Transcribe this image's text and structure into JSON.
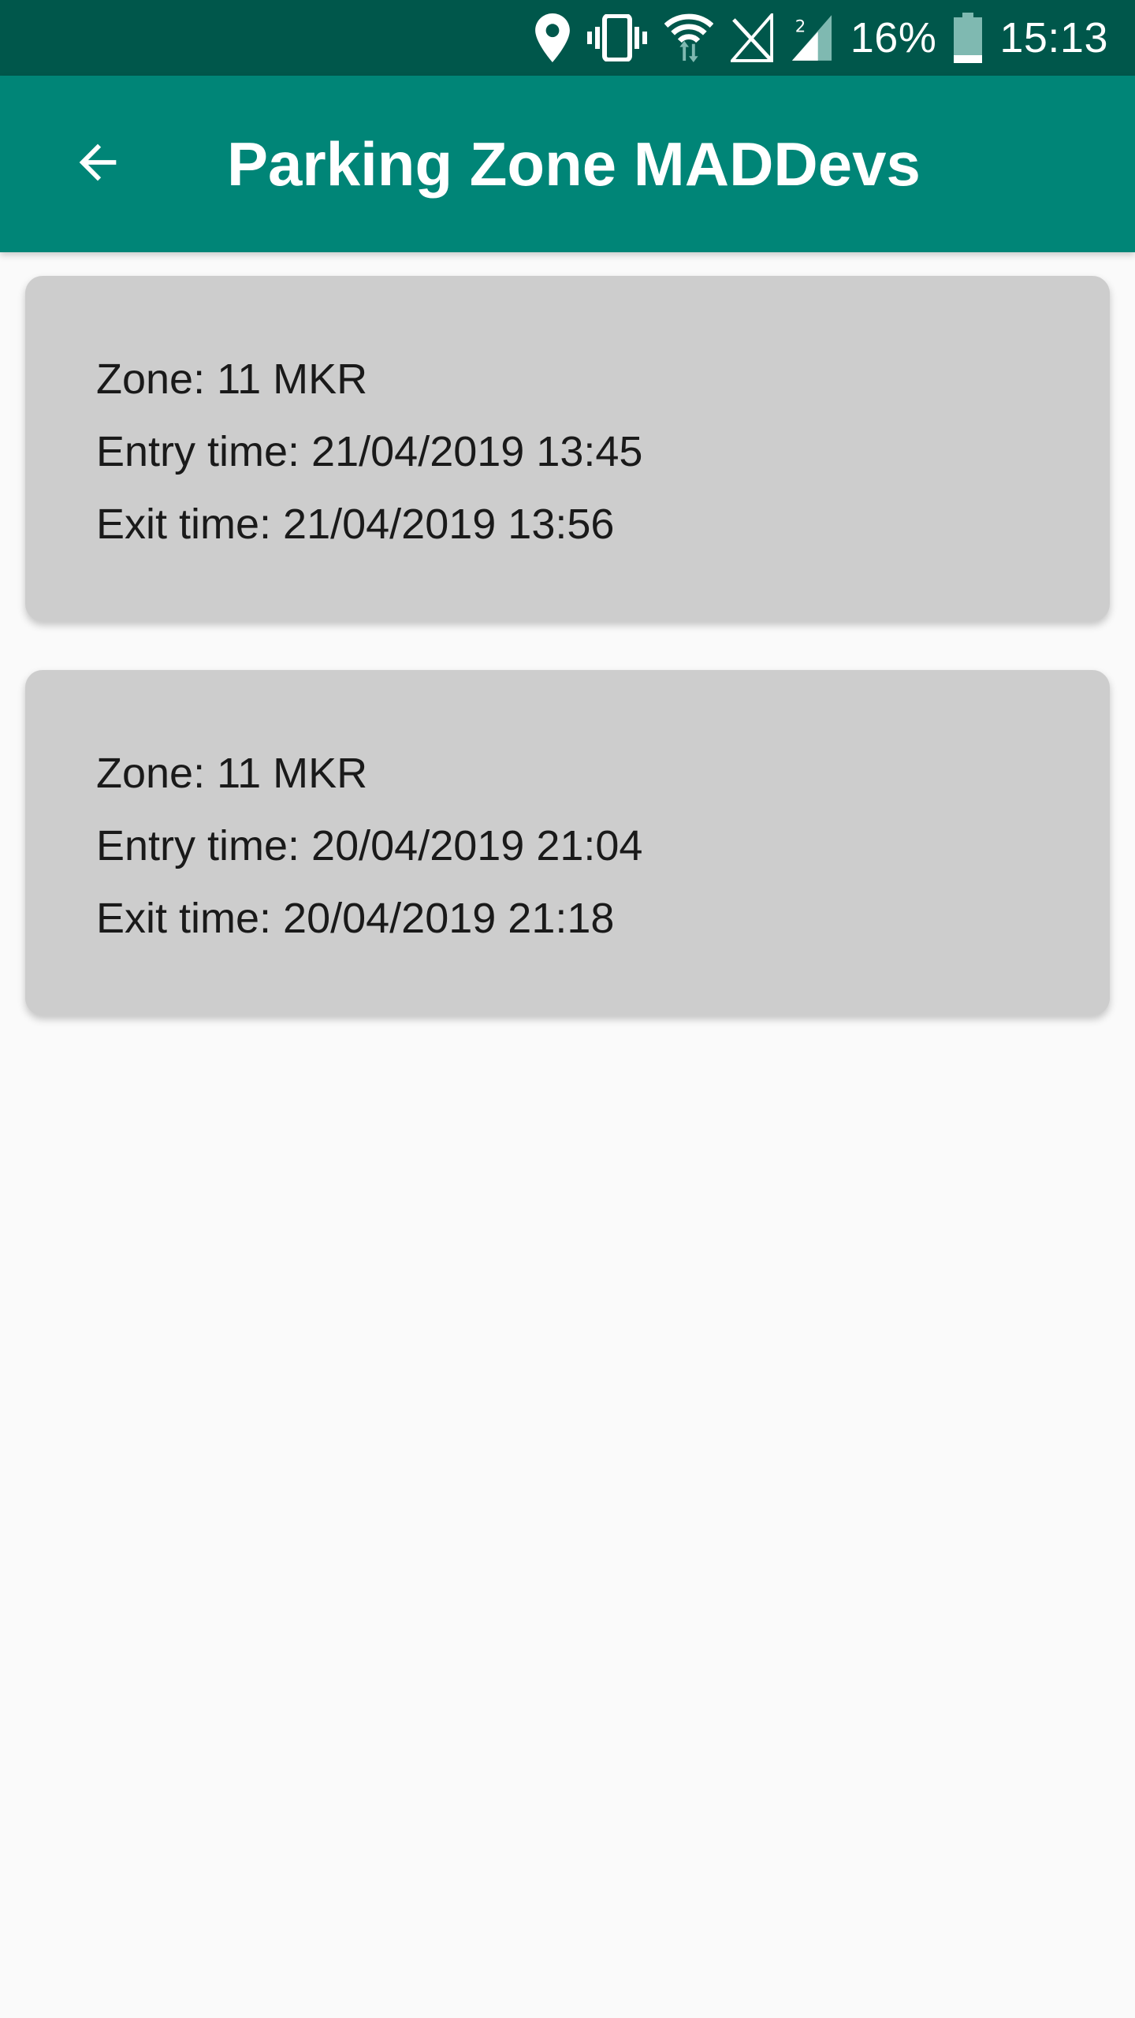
{
  "status_bar": {
    "icons": [
      "location-icon",
      "vibrate-icon",
      "wifi-icon",
      "signal-no-sim-icon",
      "signal-icon",
      "battery-icon"
    ],
    "battery": "16%",
    "time": "15:13"
  },
  "app_bar": {
    "back_icon": "arrow-back-icon",
    "title": "Parking Zone MADDevs",
    "color": "#008577"
  },
  "sessions": [
    {
      "zone": "Zone: 11 MKR",
      "entry": "Entry time: 21/04/2019 13:45",
      "exit": "Exit time: 21/04/2019 13:56"
    },
    {
      "zone": "Zone: 11 MKR",
      "entry": "Entry time: 20/04/2019 21:04",
      "exit": "Exit time: 20/04/2019 21:18"
    }
  ]
}
